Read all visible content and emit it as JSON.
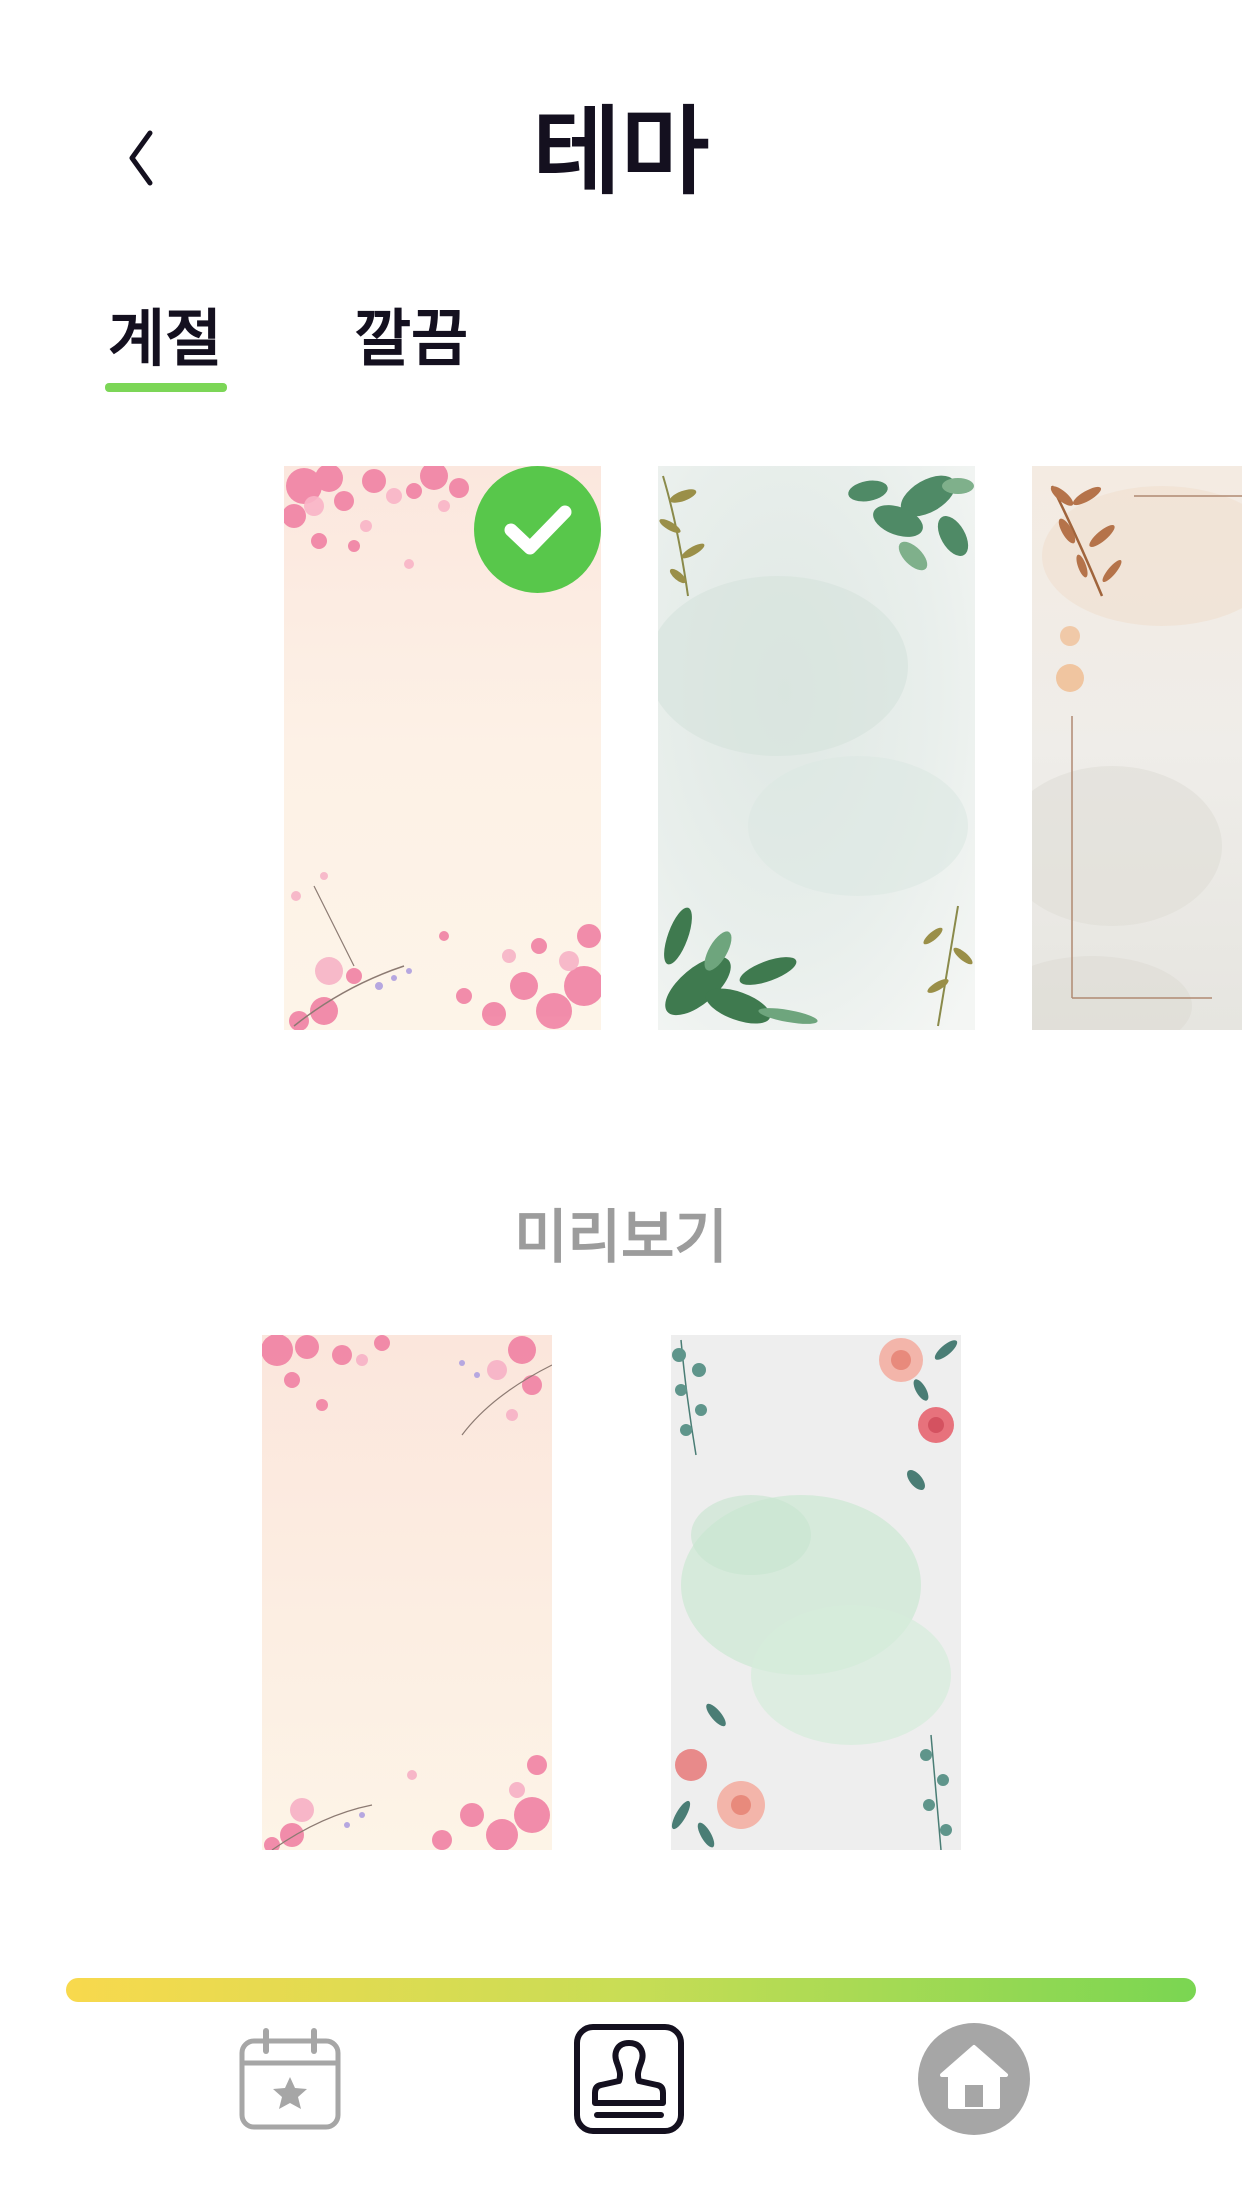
{
  "header": {
    "title": "테마",
    "back_icon": "chevron-left-icon"
  },
  "tabs": [
    {
      "label": "계절",
      "selected": true
    },
    {
      "label": "깔끔",
      "selected": false
    }
  ],
  "themes": [
    {
      "name": "cherry-blossom",
      "selected": true
    },
    {
      "name": "eucalyptus-watercolor",
      "selected": false
    },
    {
      "name": "autumn-leaf-frame",
      "selected": false
    }
  ],
  "preview": {
    "label": "미리보기"
  },
  "nav": {
    "items": [
      {
        "icon": "calendar-star-icon",
        "active": false
      },
      {
        "icon": "stamp-icon",
        "active": true
      },
      {
        "icon": "home-icon",
        "active": false
      }
    ]
  },
  "colors": {
    "accent": "#7cd657",
    "check": "#58c74b",
    "inactive": "#a6a6a6",
    "text": "#14101f"
  }
}
